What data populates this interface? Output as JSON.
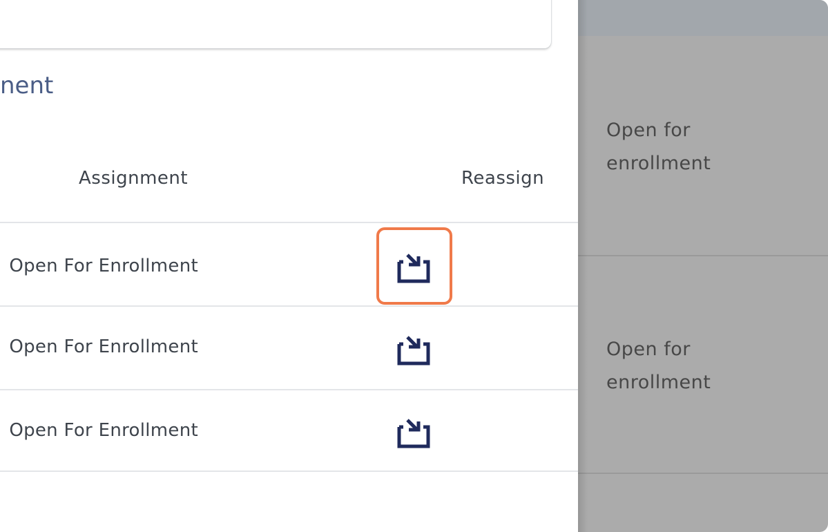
{
  "section": {
    "title_fragment": "nent"
  },
  "table": {
    "headers": {
      "assignment": "Assignment",
      "reassign": "Reassign"
    },
    "rows": [
      {
        "status": "Open For Enrollment",
        "reassign_icon": "reassign-icon",
        "highlighted": true
      },
      {
        "status": "Open For Enrollment",
        "reassign_icon": "reassign-icon",
        "highlighted": false
      },
      {
        "status": "Open For Enrollment",
        "reassign_icon": "reassign-icon",
        "highlighted": false
      }
    ]
  },
  "side_panel": {
    "cells": [
      {
        "status_line1": "Open for",
        "status_line2": "enrollment"
      },
      {
        "status_line1": "Open for",
        "status_line2": "enrollment"
      }
    ]
  },
  "colors": {
    "highlight": "#f07a4a",
    "icon": "#1f2a5c",
    "title": "#4a5d86",
    "overlay": "#ababab"
  }
}
